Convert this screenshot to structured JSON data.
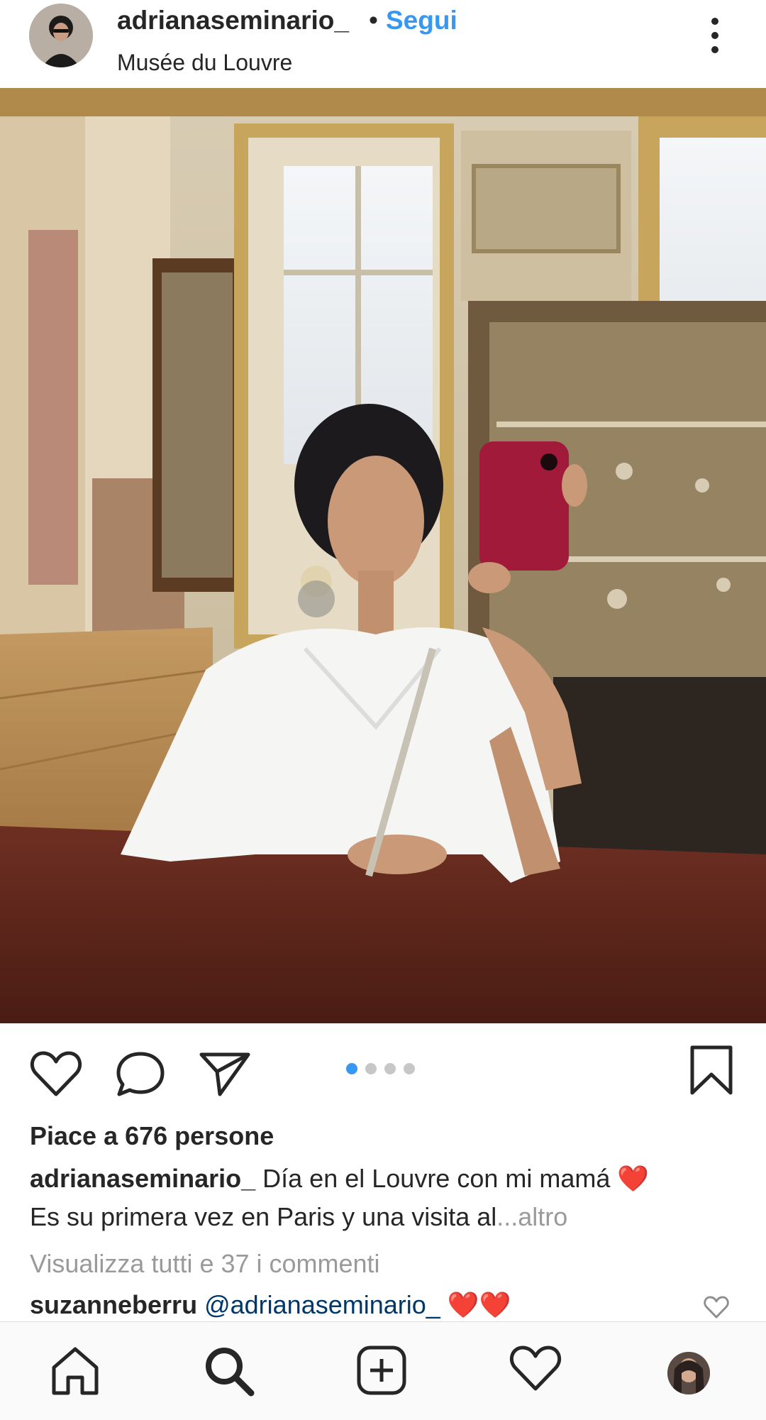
{
  "post": {
    "username": "adrianaseminario_",
    "separator": "•",
    "follow_label": "Segui",
    "location": "Musée du Louvre"
  },
  "carousel": {
    "total": 4,
    "active": 1
  },
  "likes_text": "Piace a 676 persone",
  "caption": {
    "username": "adrianaseminario_",
    "line1": " Día en el Louvre con mi mamá ❤️",
    "line2": "Es su primera vez en Paris y una visita al",
    "more_label": "...altro"
  },
  "view_comments": "Visualizza tutti e 37 i commenti",
  "comment": {
    "username": "suzanneberru",
    "mention": "@adrianaseminario_",
    "text": " ❤️❤️"
  },
  "colors": {
    "accent": "#3897f0",
    "text": "#262626",
    "muted": "#9a9a9a",
    "mention": "#00376b"
  },
  "icons": {
    "header_more": "more-vertical-icon",
    "like": "heart-icon",
    "comment": "comment-bubble-icon",
    "share": "paper-plane-icon",
    "save": "bookmark-icon",
    "comment_like": "small-heart-icon",
    "nav": [
      "home-icon",
      "search-icon",
      "add-post-icon",
      "activity-heart-icon",
      "profile-avatar"
    ]
  }
}
